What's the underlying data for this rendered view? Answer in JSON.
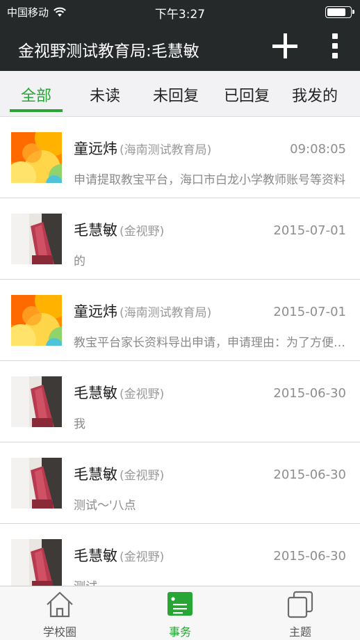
{
  "status_bar": {
    "carrier": "中国移动",
    "time": "下午3:27"
  },
  "nav": {
    "title": "金视野测试教育局:毛慧敏",
    "add_icon": "plus-icon",
    "more_icon": "more-vertical-icon"
  },
  "tabs": [
    {
      "label": "全部",
      "active": true
    },
    {
      "label": "未读",
      "active": false
    },
    {
      "label": "未回复",
      "active": false
    },
    {
      "label": "已回复",
      "active": false
    },
    {
      "label": "我发的",
      "active": false
    }
  ],
  "messages": [
    {
      "name": "童远炜",
      "org": "(海南测试教育局)",
      "time": "09:08:05",
      "preview": "申请提取教宝平台，海口市白龙小学教师账号等资料",
      "avatar": "colorful-avatar"
    },
    {
      "name": "毛慧敏",
      "org": "(金视野)",
      "time": "2015-07-01",
      "preview": "的",
      "avatar": "photo-avatar"
    },
    {
      "name": "童远炜",
      "org": "(海南测试教育局)",
      "time": "2015-07-01",
      "preview": "教宝平台家长资料导出申请，申请理由：为了方便统计",
      "avatar": "colorful-avatar"
    },
    {
      "name": "毛慧敏",
      "org": "(金视野)",
      "time": "2015-06-30",
      "preview": "我",
      "avatar": "photo-avatar"
    },
    {
      "name": "毛慧敏",
      "org": "(金视野)",
      "time": "2015-06-30",
      "preview": "测试～'八点",
      "avatar": "photo-avatar"
    },
    {
      "name": "毛慧敏",
      "org": "(金视野)",
      "time": "2015-06-30",
      "preview": "测试",
      "avatar": "photo-avatar"
    }
  ],
  "bottom_tabs": [
    {
      "label": "学校圈",
      "icon": "home-icon",
      "active": false
    },
    {
      "label": "事务",
      "icon": "document-icon",
      "active": true
    },
    {
      "label": "主题",
      "icon": "copy-icon",
      "active": false
    }
  ],
  "colors": {
    "accent": "#27a535",
    "nav_background": "#26292a"
  }
}
